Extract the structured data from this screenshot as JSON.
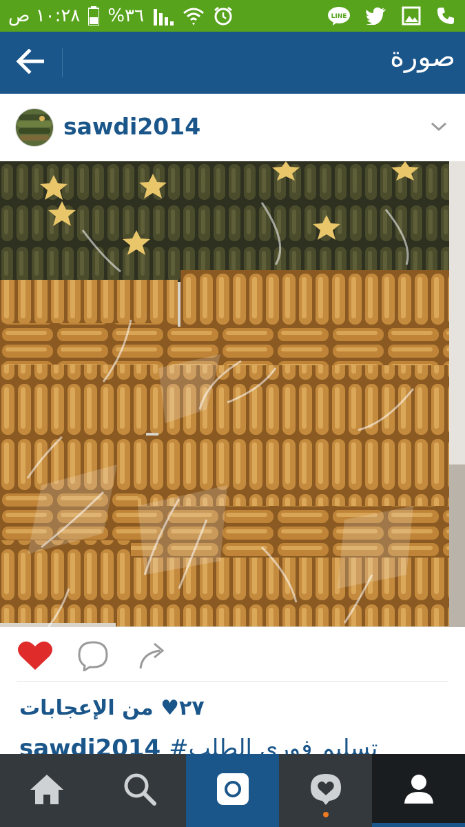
{
  "status_bar": {
    "time": "١٠:٢٨ ص",
    "battery": "%٣٦",
    "icons": [
      "phone-icon",
      "gallery-icon",
      "twitter-icon",
      "line-icon",
      "alarm-icon",
      "wifi-icon",
      "signal-icon",
      "battery-icon"
    ],
    "line_label": "LINE",
    "color": "#57a31c"
  },
  "app_bar": {
    "title": "صورة",
    "back_icon": "arrow-left-icon",
    "color": "#1a568a"
  },
  "post": {
    "username": "sawdi2014",
    "menu_icon": "chevron-down-icon",
    "photo_description_icon": "food-photo",
    "actions": {
      "like_icon": "heart-icon",
      "like_color": "#e02b2b",
      "comment_icon": "comment-bubble-icon",
      "share_icon": "share-arrow-icon"
    },
    "likes_text": "٢٧♥ من الإعجابات",
    "caption_user": "sawdi2014",
    "caption_text": "#تسليم فورى الطلب"
  },
  "bottom_nav": {
    "items": [
      "home-icon",
      "search-icon",
      "camera-icon",
      "activity-icon",
      "profile-icon"
    ],
    "active": "profile-icon",
    "notification_dot_color": "#f07a22"
  }
}
